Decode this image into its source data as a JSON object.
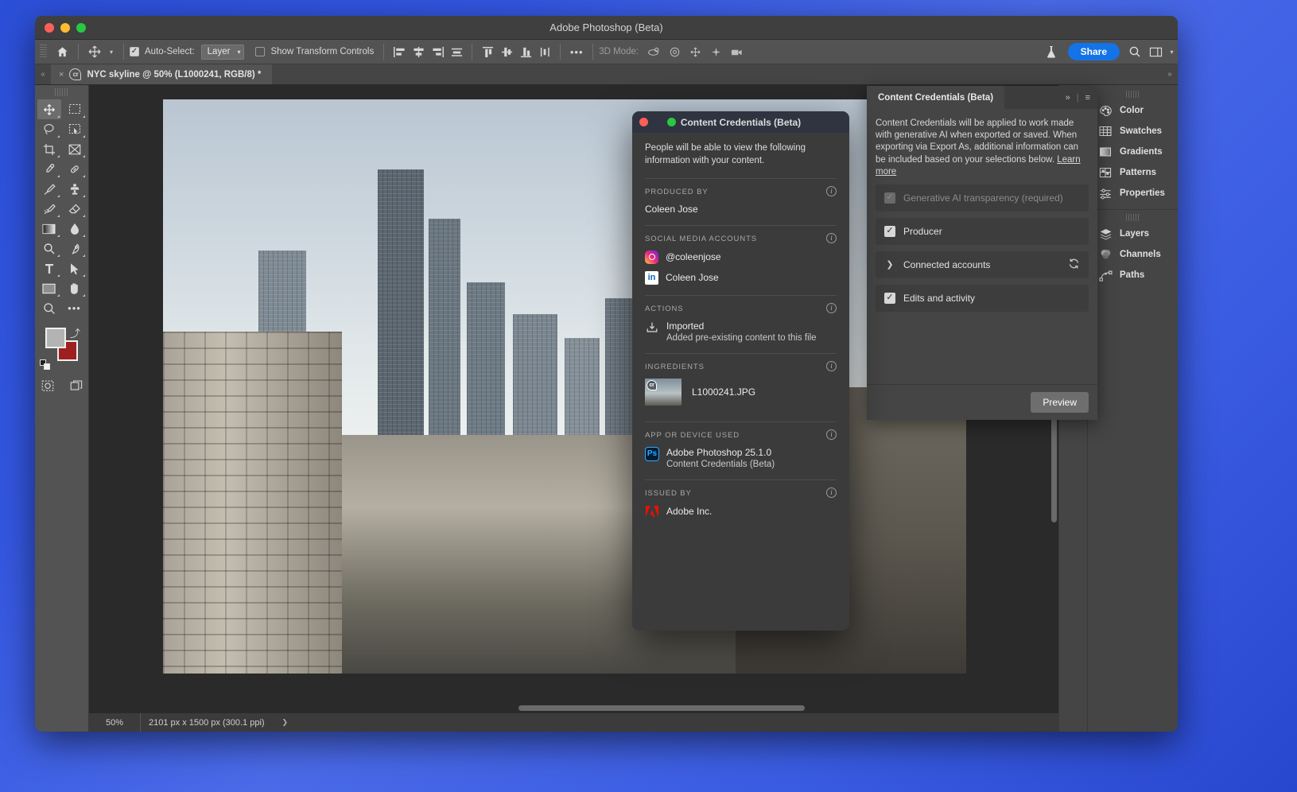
{
  "window": {
    "title": "Adobe Photoshop (Beta)",
    "traffic": {
      "close": "close-button",
      "minimize": "minimize-button",
      "zoom": "zoom-button"
    }
  },
  "options_bar": {
    "home_label": "home-icon",
    "move_tool_label": "move-tool-icon",
    "auto_select_label": "Auto-Select:",
    "auto_select_checked": "✓",
    "auto_select_value": "Layer",
    "show_transform_label": "Show Transform Controls",
    "show_transform_checked": "",
    "more_label": "•••",
    "three_d_mode_label": "3D Mode:",
    "share_label": "Share",
    "search_label": "search-icon",
    "workspace_label": "workspace-icon"
  },
  "tab": {
    "close": "×",
    "title": "NYC skyline @ 50% (L1000241, RGB/8) *",
    "cr_badge": "cr"
  },
  "tools": [
    {
      "name": "move-tool",
      "glyph": "✥",
      "active": true
    },
    {
      "name": "rectangular-marquee-tool",
      "glyph": "▭",
      "active": false
    },
    {
      "name": "lasso-tool",
      "glyph": "◯",
      "active": false
    },
    {
      "name": "object-selection-tool",
      "glyph": "▧",
      "active": false
    },
    {
      "name": "crop-tool",
      "glyph": "⌗",
      "active": false
    },
    {
      "name": "frame-tool",
      "glyph": "⊠",
      "active": false
    },
    {
      "name": "eyedropper-tool",
      "glyph": "⚲",
      "active": false
    },
    {
      "name": "spot-healing-brush-tool",
      "glyph": "⚕",
      "active": false
    },
    {
      "name": "brush-tool",
      "glyph": "✎",
      "active": false
    },
    {
      "name": "clone-stamp-tool",
      "glyph": "⎙",
      "active": false
    },
    {
      "name": "history-brush-tool",
      "glyph": "✒",
      "active": false
    },
    {
      "name": "eraser-tool",
      "glyph": "◧",
      "active": false
    },
    {
      "name": "gradient-tool",
      "glyph": "▤",
      "active": false
    },
    {
      "name": "blur-tool",
      "glyph": "💧",
      "active": false
    },
    {
      "name": "dodge-tool",
      "glyph": "○",
      "active": false
    },
    {
      "name": "pen-tool",
      "glyph": "✐",
      "active": false
    },
    {
      "name": "type-tool",
      "glyph": "T",
      "active": false
    },
    {
      "name": "path-selection-tool",
      "glyph": "➤",
      "active": false
    },
    {
      "name": "rectangle-tool",
      "glyph": "▭",
      "active": false
    },
    {
      "name": "hand-tool",
      "glyph": "✋",
      "active": false
    },
    {
      "name": "zoom-tool",
      "glyph": "⚲",
      "active": false
    },
    {
      "name": "edit-toolbar",
      "glyph": "•••",
      "active": false
    }
  ],
  "color_swatches": {
    "foreground": "#b3b3b3",
    "background": "#9e1f1f",
    "swap": "swap-colors-icon",
    "defaults": "default-colors-icon"
  },
  "tools_bottom": [
    {
      "name": "quick-mask-toggle",
      "glyph": "⬚"
    },
    {
      "name": "screen-mode-toggle",
      "glyph": "❐"
    }
  ],
  "status_bar": {
    "zoom": "50%",
    "doc_size": "2101 px x 1500 px (300.1 ppi)",
    "expand_arrow": "❯"
  },
  "cc_dialog": {
    "title": "Content Credentials (Beta)",
    "intro": "People will be able to view the following information with your content.",
    "sections": [
      {
        "heading": "PRODUCED BY",
        "value": "Coleen Jose"
      },
      {
        "heading": "SOCIAL MEDIA ACCOUNTS"
      },
      {
        "heading": "ACTIONS"
      },
      {
        "heading": "INGREDIENTS"
      },
      {
        "heading": "APP OR DEVICE USED"
      },
      {
        "heading": "ISSUED BY"
      }
    ],
    "social": [
      {
        "platform": "instagram",
        "handle": "@coleenjose"
      },
      {
        "platform": "linkedin",
        "handle": "Coleen Jose"
      }
    ],
    "actions": [
      {
        "title": "Imported",
        "subtitle": "Added pre-existing content to this file",
        "icon": "import-icon"
      }
    ],
    "ingredients": [
      {
        "filename": "L1000241.JPG",
        "badge": "cr"
      }
    ],
    "app": {
      "name": "Adobe Photoshop 25.1.0",
      "subtitle": "Content Credentials (Beta)",
      "icon": "Ps"
    },
    "issuer": {
      "name": "Adobe Inc.",
      "icon": "adobe-logo"
    },
    "info_icon": "i"
  },
  "cc_panel": {
    "tab_label": "Content Credentials (Beta)",
    "collapse_icon": "»",
    "menu_icon": "≡",
    "description": "Content Credentials will be applied to work made with generative AI when exported or saved. When exporting via Export As, additional information can be included based on your selections below. ",
    "learn_more": "Learn more",
    "options": [
      {
        "label": "Generative AI transparency (required)",
        "checked": true,
        "disabled": true,
        "type": "checkbox"
      },
      {
        "label": "Producer",
        "checked": true,
        "disabled": false,
        "type": "checkbox"
      },
      {
        "label": "Connected accounts",
        "checked": false,
        "disabled": false,
        "type": "expander",
        "refresh": "refresh-icon"
      },
      {
        "label": "Edits and activity",
        "checked": true,
        "disabled": false,
        "type": "checkbox"
      }
    ],
    "preview_label": "Preview"
  },
  "right_dock": {
    "rail_badge": "cr",
    "groups": [
      {
        "items": [
          {
            "label": "Color",
            "icon": "color-palette-icon"
          },
          {
            "label": "Swatches",
            "icon": "swatches-grid-icon"
          },
          {
            "label": "Gradients",
            "icon": "gradient-icon"
          },
          {
            "label": "Patterns",
            "icon": "patterns-icon"
          },
          {
            "label": "Properties",
            "icon": "properties-sliders-icon"
          }
        ]
      },
      {
        "items": [
          {
            "label": "Layers",
            "icon": "layers-icon"
          },
          {
            "label": "Channels",
            "icon": "channels-icon"
          },
          {
            "label": "Paths",
            "icon": "paths-icon"
          }
        ]
      }
    ]
  },
  "colors": {
    "accent": "#1473e6",
    "panel_bg": "#454545",
    "window_bg": "#535353",
    "canvas_bg": "#2a2a2a",
    "dialog_bg": "#3b3b3b",
    "dialog_titlebar": "#2f3440"
  }
}
